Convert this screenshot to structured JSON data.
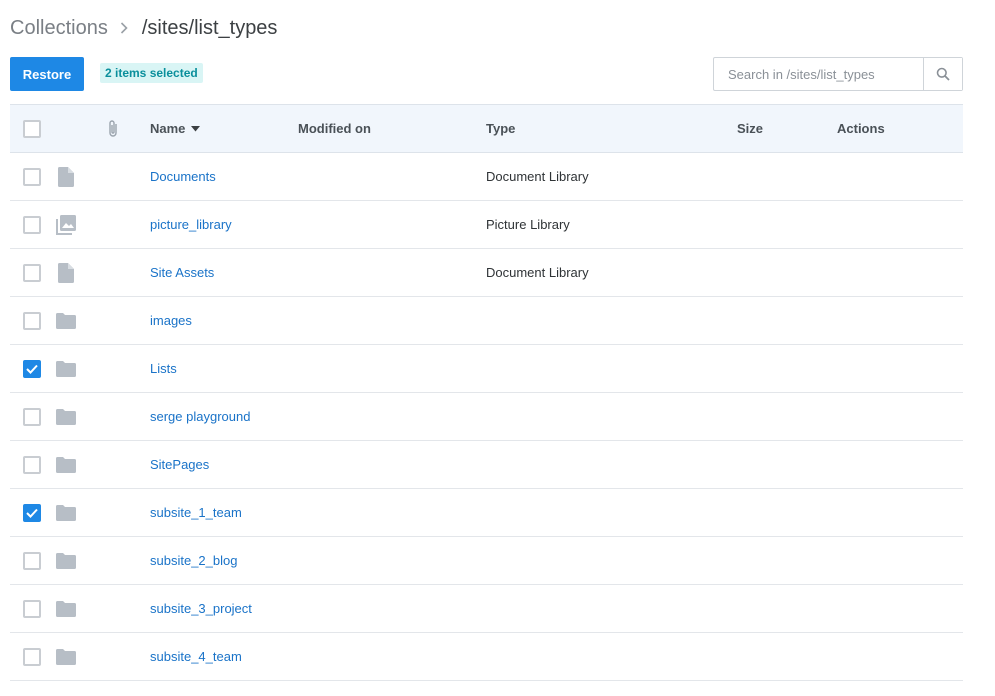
{
  "breadcrumb": {
    "root": "Collections",
    "current": "/sites/list_types"
  },
  "toolbar": {
    "restore_label": "Restore",
    "selection_badge": "2 items selected",
    "search_placeholder": "Search in /sites/list_types"
  },
  "table": {
    "columns": {
      "name": "Name",
      "modified": "Modified on",
      "type": "Type",
      "size": "Size",
      "actions": "Actions"
    },
    "sort": {
      "column": "Name",
      "direction": "descending-caret"
    },
    "rows": [
      {
        "name": "Documents",
        "modified": "",
        "type": "Document Library",
        "size": "",
        "icon": "document-icon",
        "checked": false
      },
      {
        "name": "picture_library",
        "modified": "",
        "type": "Picture Library",
        "size": "",
        "icon": "image-gallery-icon",
        "checked": false
      },
      {
        "name": "Site Assets",
        "modified": "",
        "type": "Document Library",
        "size": "",
        "icon": "document-icon",
        "checked": false
      },
      {
        "name": "images",
        "modified": "",
        "type": "",
        "size": "",
        "icon": "folder-icon",
        "checked": false
      },
      {
        "name": "Lists",
        "modified": "",
        "type": "",
        "size": "",
        "icon": "folder-icon",
        "checked": true
      },
      {
        "name": "serge playground",
        "modified": "",
        "type": "",
        "size": "",
        "icon": "folder-icon",
        "checked": false
      },
      {
        "name": "SitePages",
        "modified": "",
        "type": "",
        "size": "",
        "icon": "folder-icon",
        "checked": false
      },
      {
        "name": "subsite_1_team",
        "modified": "",
        "type": "",
        "size": "",
        "icon": "folder-icon",
        "checked": true
      },
      {
        "name": "subsite_2_blog",
        "modified": "",
        "type": "",
        "size": "",
        "icon": "folder-icon",
        "checked": false
      },
      {
        "name": "subsite_3_project",
        "modified": "",
        "type": "",
        "size": "",
        "icon": "folder-icon",
        "checked": false
      },
      {
        "name": "subsite_4_team",
        "modified": "",
        "type": "",
        "size": "",
        "icon": "folder-icon",
        "checked": false
      }
    ]
  },
  "colors": {
    "primary": "#1e88e5",
    "link": "#1a73c8",
    "badge_bg": "#d9f5f5",
    "badge_text": "#0a8f9c",
    "header_bg": "#f1f6fc",
    "icon_gray": "#b7bec6"
  }
}
